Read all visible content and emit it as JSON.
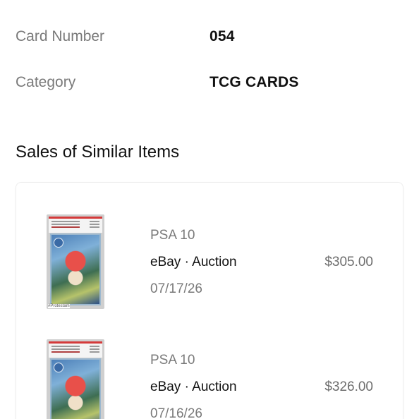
{
  "details": [
    {
      "label": "Card Number",
      "value": "054"
    },
    {
      "label": "Category",
      "value": "TCG CARDS"
    }
  ],
  "sales_section": {
    "title": "Sales of Similar Items",
    "items": [
      {
        "grade": "PSA 10",
        "venue": "eBay · Auction",
        "price": "$305.00",
        "date": "07/17/26",
        "watermark": "#Protestam"
      },
      {
        "grade": "PSA 10",
        "venue": "eBay · Auction",
        "price": "$326.00",
        "date": "07/16/26"
      }
    ]
  }
}
